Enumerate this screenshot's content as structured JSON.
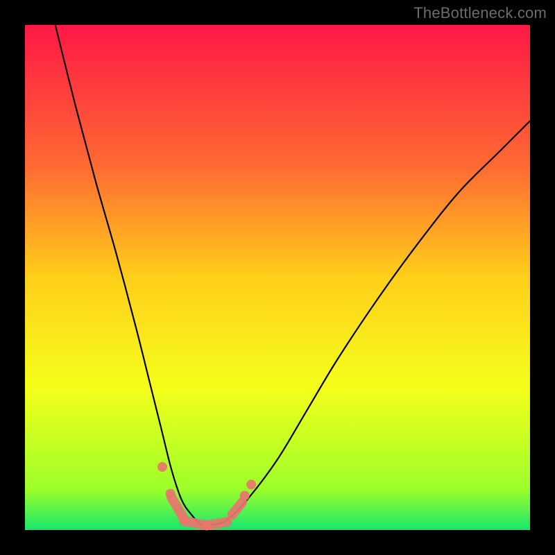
{
  "watermark": "TheBottleneck.com",
  "colors": {
    "background_frame": "#000000",
    "gradient_stops": [
      "#ff1846",
      "#ff6a33",
      "#ffcf1a",
      "#f4ff1a",
      "#9cff2a",
      "#17e66e"
    ],
    "curve_stroke": "#000000",
    "marker_color": "#e8756d"
  },
  "chart_data": {
    "type": "line",
    "title": "",
    "xlabel": "",
    "ylabel": "",
    "xlim": [
      0,
      100
    ],
    "ylim": [
      0,
      100
    ],
    "series": [
      {
        "name": "bottleneck-curve",
        "x": [
          6,
          10,
          14,
          18,
          22,
          25,
          27,
          29,
          31,
          33,
          35,
          37,
          40,
          44,
          50,
          56,
          62,
          70,
          78,
          86,
          94,
          100
        ],
        "y": [
          100,
          84,
          69,
          55,
          40,
          28,
          20,
          12,
          6,
          3,
          1,
          1,
          2,
          6,
          14,
          24,
          34,
          46,
          57,
          67,
          75,
          81
        ]
      }
    ],
    "markers": [
      {
        "x": 27.2,
        "y": 12.5,
        "kind": "dot"
      },
      {
        "x": 28.8,
        "y": 7.2,
        "kind": "dot"
      },
      {
        "x1": 29.0,
        "y1": 6.5,
        "x2": 31.5,
        "y2": 2.2,
        "kind": "segment"
      },
      {
        "x1": 31.5,
        "y1": 1.8,
        "x2": 36.0,
        "y2": 0.9,
        "kind": "segment"
      },
      {
        "x1": 36.0,
        "y1": 0.9,
        "x2": 40.0,
        "y2": 1.6,
        "kind": "segment"
      },
      {
        "x1": 41.0,
        "y1": 3.0,
        "x2": 43.0,
        "y2": 5.5,
        "kind": "segment"
      },
      {
        "x": 43.5,
        "y": 6.8,
        "kind": "dot"
      },
      {
        "x": 44.8,
        "y": 9.0,
        "kind": "dot"
      }
    ]
  }
}
